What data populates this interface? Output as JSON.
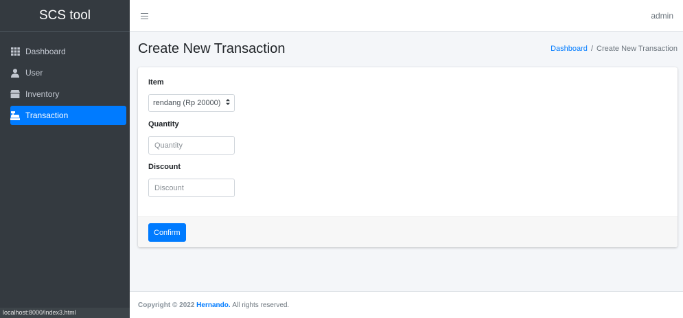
{
  "brand": {
    "title": "SCS tool"
  },
  "sidebar": {
    "items": [
      {
        "label": "Dashboard",
        "icon": "grid-icon",
        "active": false
      },
      {
        "label": "User",
        "icon": "user-icon",
        "active": false
      },
      {
        "label": "Inventory",
        "icon": "box-icon",
        "active": false
      },
      {
        "label": "Transaction",
        "icon": "cash-register-icon",
        "active": true
      }
    ],
    "status_url": "localhost:8000/index3.html"
  },
  "topbar": {
    "menu_icon": "hamburger-icon",
    "user": "admin"
  },
  "header": {
    "title": "Create New Transaction",
    "breadcrumb": {
      "home": "Dashboard",
      "separator": "/",
      "current": "Create New Transaction"
    }
  },
  "form": {
    "item": {
      "label": "Item",
      "value": "rendang (Rp 20000)"
    },
    "quantity": {
      "label": "Quantity",
      "placeholder": "Quantity",
      "value": ""
    },
    "discount": {
      "label": "Discount",
      "placeholder": "Discount",
      "value": ""
    },
    "confirm_label": "Confirm"
  },
  "footer": {
    "prefix": "Copyright © 2022",
    "owner": "Hernando.",
    "suffix": "All rights reserved."
  },
  "colors": {
    "accent": "#007bff",
    "sidebar": "#343a40"
  }
}
